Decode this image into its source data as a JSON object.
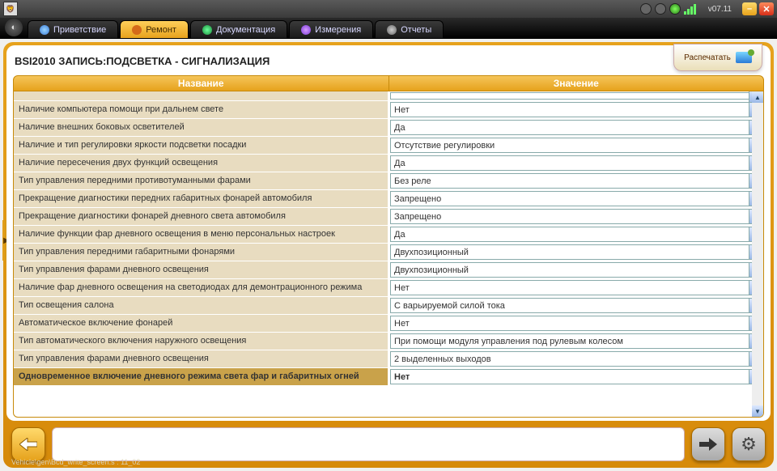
{
  "titlebar": {
    "version": "v07.11"
  },
  "tabs": [
    {
      "label": "Приветствие"
    },
    {
      "label": "Ремонт"
    },
    {
      "label": "Документация"
    },
    {
      "label": "Измерения"
    },
    {
      "label": "Отчеты"
    }
  ],
  "page_title": "BSI2010  ЗАПИСЬ:ПОДСВЕТКА - СИГНАЛИЗАЦИЯ",
  "print_label": "Распечатать",
  "columns": {
    "name": "Название",
    "value": "Значение"
  },
  "rows": [
    {
      "name": "Наличие компьютера помощи при дальнем свете",
      "value": "Нет"
    },
    {
      "name": "Наличие внешних боковых осветителей",
      "value": "Да"
    },
    {
      "name": "Наличие и тип регулировки яркости подсветки посадки",
      "value": "Отсутствие регулировки"
    },
    {
      "name": "Наличие пересечения двух функций освещения",
      "value": "Да"
    },
    {
      "name": "Тип управления передними противотуманными фарами",
      "value": "Без реле"
    },
    {
      "name": "Прекращение диагностики передних габаритных фонарей автомобиля",
      "value": "Запрещено"
    },
    {
      "name": "Прекращение диагностики фонарей дневного света автомобиля",
      "value": "Запрещено"
    },
    {
      "name": "Наличие функции фар дневного освещения в меню персональных настроек",
      "value": "Да"
    },
    {
      "name": "Тип управления передними габаритными фонарями",
      "value": "Двухпозиционный"
    },
    {
      "name": "Тип управления фарами дневного освещения",
      "value": "Двухпозиционный"
    },
    {
      "name": "Наличие фар дневного освещения на светодиодах для демонтрационного режима",
      "value": "Нет"
    },
    {
      "name": "Тип освещения салона",
      "value": "С варьируемой силой тока"
    },
    {
      "name": "Автоматическое включение фонарей",
      "value": "Нет"
    },
    {
      "name": "Тип автоматического включения наружного освещения",
      "value": "При помощи модуля управления под рулевым колесом"
    },
    {
      "name": "Тип управления фарами дневного освещения",
      "value": "2 выделенных выходов"
    },
    {
      "name": "Одновременное включение дневного режима света фар и габаритных огней",
      "value": "Нет",
      "highlight": true
    }
  ],
  "status": "Vehicle\\gen\\Bcd_write_screen.s : 11_02"
}
